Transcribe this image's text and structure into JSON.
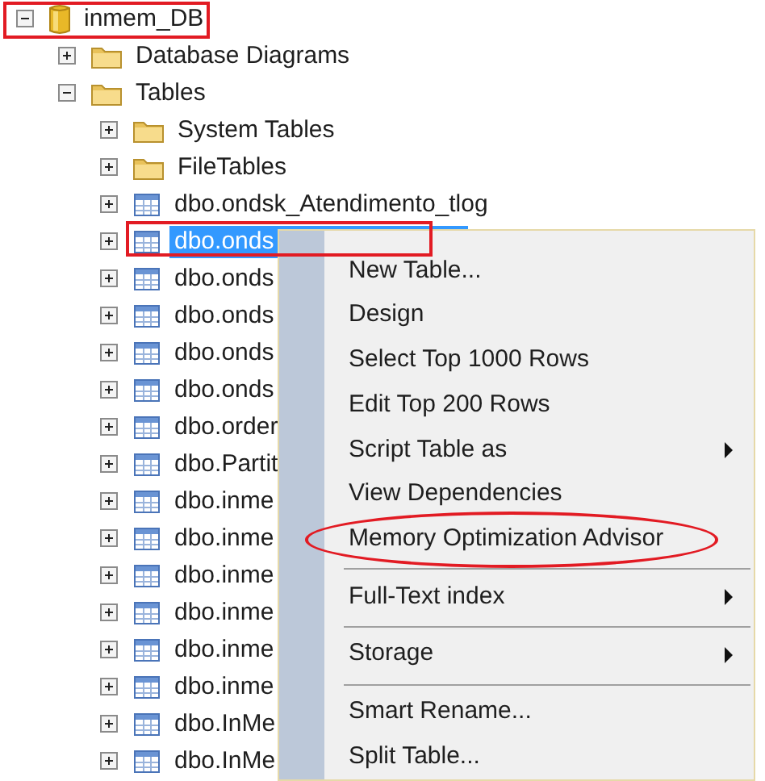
{
  "tree": {
    "label": "inmem_DB",
    "kind": "database",
    "expanded": true,
    "annotated": true,
    "children": [
      {
        "label": "Database Diagrams",
        "kind": "folder",
        "expanded": false
      },
      {
        "label": "Tables",
        "kind": "folder",
        "expanded": true,
        "children": [
          {
            "label": "System Tables",
            "kind": "folder",
            "expanded": false
          },
          {
            "label": "FileTables",
            "kind": "folder",
            "expanded": false
          },
          {
            "label": "dbo.ondsk_Atendimento_tlog",
            "kind": "table",
            "expanded": false,
            "selected": false
          },
          {
            "label": "dbo.onds",
            "kind": "table",
            "expanded": false,
            "selected": true,
            "annotated": true
          },
          {
            "label": "dbo.onds",
            "kind": "table",
            "expanded": false,
            "selected": false
          },
          {
            "label": "dbo.onds",
            "kind": "table",
            "expanded": false,
            "selected": false
          },
          {
            "label": "dbo.onds",
            "kind": "table",
            "expanded": false,
            "selected": false
          },
          {
            "label": "dbo.onds",
            "kind": "table",
            "expanded": false,
            "selected": false
          },
          {
            "label": "dbo.order",
            "kind": "table",
            "expanded": false,
            "selected": false
          },
          {
            "label": "dbo.Partit",
            "kind": "table",
            "expanded": false,
            "selected": false
          },
          {
            "label": "dbo.inme",
            "kind": "table",
            "expanded": false,
            "selected": false
          },
          {
            "label": "dbo.inme",
            "kind": "table",
            "expanded": false,
            "selected": false
          },
          {
            "label": "dbo.inme",
            "kind": "table",
            "expanded": false,
            "selected": false
          },
          {
            "label": "dbo.inme",
            "kind": "table",
            "expanded": false,
            "selected": false
          },
          {
            "label": "dbo.inme",
            "kind": "table",
            "expanded": false,
            "selected": false
          },
          {
            "label": "dbo.inme",
            "kind": "table",
            "expanded": false,
            "selected": false
          },
          {
            "label": "dbo.InMe",
            "kind": "table",
            "expanded": false,
            "selected": false
          },
          {
            "label": "dbo.InMe",
            "kind": "table",
            "expanded": false,
            "selected": false
          }
        ]
      }
    ]
  },
  "context_menu": {
    "items": [
      {
        "kind": "item",
        "label": "New Table...",
        "submenu": false
      },
      {
        "kind": "item",
        "label": "Design",
        "submenu": false
      },
      {
        "kind": "item",
        "label": "Select Top 1000 Rows",
        "submenu": false
      },
      {
        "kind": "item",
        "label": "Edit Top 200 Rows",
        "submenu": false
      },
      {
        "kind": "item",
        "label": "Script Table as",
        "submenu": true
      },
      {
        "kind": "item",
        "label": "View Dependencies",
        "submenu": false
      },
      {
        "kind": "item",
        "label": "Memory Optimization Advisor",
        "submenu": false,
        "annotated": true
      },
      {
        "kind": "separator"
      },
      {
        "kind": "item",
        "label": "Full-Text index",
        "submenu": true
      },
      {
        "kind": "separator"
      },
      {
        "kind": "item",
        "label": "Storage",
        "submenu": true
      },
      {
        "kind": "separator"
      },
      {
        "kind": "item",
        "label": "Smart Rename...",
        "submenu": false
      },
      {
        "kind": "item",
        "label": "Split Table...",
        "submenu": false
      }
    ]
  }
}
